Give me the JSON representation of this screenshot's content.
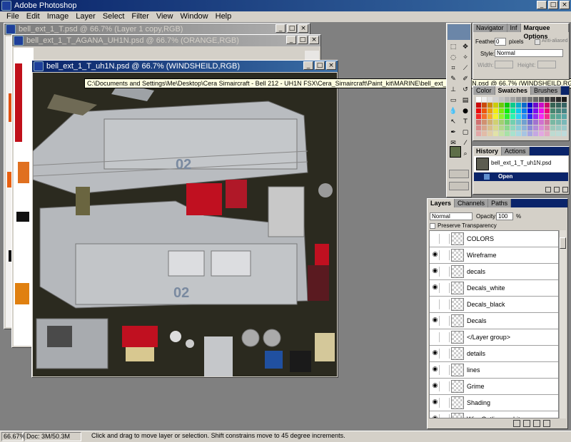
{
  "app": {
    "title": "Adobe Photoshop"
  },
  "menu": [
    "File",
    "Edit",
    "Image",
    "Layer",
    "Select",
    "Filter",
    "View",
    "Window",
    "Help"
  ],
  "docs": [
    {
      "title": "bell_ext_1_T.psd @ 66.7% (Layer 1 copy,RGB)"
    },
    {
      "title": "bell_ext_1_T_AGANA_UH1N.psd @ 66.7% (ORANGE,RGB)"
    },
    {
      "title": "bell_ext_1_T_uh1N.psd @ 66.7% (WINDSHEILD,RGB)"
    }
  ],
  "tooltip": "C:\\Documents and Settings\\Me\\Desktop\\Cera Simaircraft - Bell 212 - UH1N FSX\\Cera_Simaircraft\\Paint_kit\\MARINE\\bell_ext_1_T_uh1N.psd @ 66.7% (WINDSHEILD,RGB)",
  "heli": {
    "number_top": "02",
    "number_bottom": "02"
  },
  "options": {
    "tabs": [
      "Navigator",
      "Inf",
      "Marquee Options"
    ],
    "feather_label": "Feather:",
    "feather_value": "0",
    "feather_unit": "pixels",
    "antialiased": "Anti-aliased",
    "style_label": "Style:",
    "style_value": "Normal",
    "width_label": "Width:",
    "height_label": "Height:"
  },
  "color_palette": {
    "tabs": [
      "Color",
      "Swatches",
      "Brushes"
    ]
  },
  "history": {
    "tabs": [
      "History",
      "Actions"
    ],
    "snapshot": "bell_ext_1_T_uh1N.psd",
    "items": [
      "Open"
    ]
  },
  "layers": {
    "tabs": [
      "Layers",
      "Channels",
      "Paths"
    ],
    "blend_mode": "Normal",
    "opacity_label": "Opacity:",
    "opacity_value": "100",
    "opacity_unit": "%",
    "preserve": "Preserve Transparency",
    "rows": [
      "COLORS",
      "Wireframe",
      "decals",
      "Decals_white",
      "Decals_black",
      "Decals",
      "</Layer group>",
      "details",
      "lines",
      "Grime",
      "Shading",
      "Win_Outlines_white"
    ]
  },
  "status": {
    "zoom": "66.67%",
    "doc": "Doc: 3M/50.3M",
    "hint": "Click and drag to move layer or selection. Shift constrains move to 45 degree increments."
  },
  "colors": {
    "accent": "#0a246a",
    "face": "#d4d0c8",
    "workspace": "#808080"
  }
}
